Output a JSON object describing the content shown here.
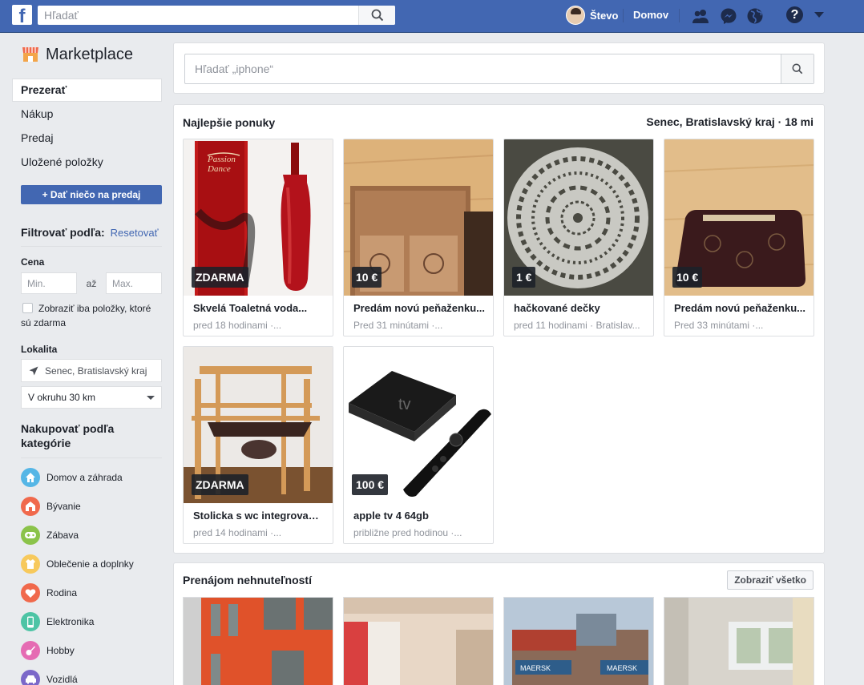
{
  "topbar": {
    "search_placeholder": "Hľadať",
    "user_name": "Števo",
    "home_label": "Domov"
  },
  "sidebar": {
    "title": "Marketplace",
    "nav": [
      {
        "label": "Prezerať",
        "active": true
      },
      {
        "label": "Nákup"
      },
      {
        "label": "Predaj"
      },
      {
        "label": "Uložené položky"
      }
    ],
    "sell_button": "+ Dať niečo na predaj",
    "filter_title": "Filtrovať podľa:",
    "reset_label": "Resetovať",
    "price_label": "Cena",
    "price_min_placeholder": "Min.",
    "price_to": "až",
    "price_max_placeholder": "Max.",
    "free_only_label": "Zobraziť iba položky, ktoré sú zdarma",
    "location_label": "Lokalita",
    "location_value": "Senec, Bratislavský kraj",
    "radius_value": "V okruhu 30 km",
    "categories_title": "Nakupovať podľa kategórie",
    "categories": [
      {
        "label": "Domov a záhrada",
        "color": "#55b6e6",
        "icon": "house-icon"
      },
      {
        "label": "Bývanie",
        "color": "#f0694c",
        "icon": "home-building-icon"
      },
      {
        "label": "Zábava",
        "color": "#8bc34a",
        "icon": "gamepad-icon"
      },
      {
        "label": "Oblečenie a doplnky",
        "color": "#f7c95c",
        "icon": "clothing-icon"
      },
      {
        "label": "Rodina",
        "color": "#f0694c",
        "icon": "heart-icon"
      },
      {
        "label": "Elektronika",
        "color": "#4dc4a5",
        "icon": "phone-icon"
      },
      {
        "label": "Hobby",
        "color": "#e56cb3",
        "icon": "guitar-icon"
      },
      {
        "label": "Vozidlá",
        "color": "#7b68c9",
        "icon": "car-icon"
      }
    ]
  },
  "main": {
    "search_placeholder": "Hľadať „iphone“",
    "deals_title": "Najlepšie ponuky",
    "deals_location": "Senec, Bratislavský kraj · 18 mi",
    "listings": [
      {
        "price": "ZDARMA",
        "title": "Skvelá Toaletná voda...",
        "meta": "pred 18 hodinami ·..."
      },
      {
        "price": "10 €",
        "title": "Predám novú peňaženku...",
        "meta": "Pred 31 minútami ·..."
      },
      {
        "price": "1 €",
        "title": "hačkované dečky",
        "meta": "pred 11 hodinami · Bratislav..."
      },
      {
        "price": "10 €",
        "title": "Predám novú peňaženku...",
        "meta": "Pred 33 minútami ·..."
      },
      {
        "price": "ZDARMA",
        "title": "Stolicka s wc integrovany...",
        "meta": "pred 14 hodinami ·..."
      },
      {
        "price": "100 €",
        "title": "apple tv 4 64gb",
        "meta": "približne pred hodinou ·..."
      }
    ],
    "rentals_title": "Prenájom nehnuteľností",
    "show_all": "Zobraziť všetko"
  }
}
